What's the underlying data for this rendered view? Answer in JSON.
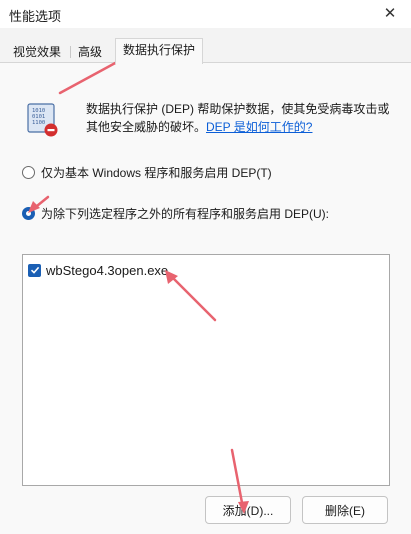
{
  "window": {
    "title": "性能选项",
    "close_icon": "close-icon"
  },
  "tabs": [
    {
      "label": "视觉效果"
    },
    {
      "label": "高级"
    },
    {
      "label": "数据执行保护"
    }
  ],
  "dep": {
    "icon": "dep-shield-icon",
    "description": "数据执行保护 (DEP) 帮助保护数据，使其免受病毒攻击或其他安全威胁的破坏。",
    "link": "DEP 是如何工作的?"
  },
  "options": {
    "essential_only": "仅为基本 Windows 程序和服务启用 DEP(T)",
    "all_except": "为除下列选定程序之外的所有程序和服务启用 DEP(U):",
    "selected": "all_except"
  },
  "program_list": [
    {
      "name": "wbStego4.3open.exe",
      "checked": true
    }
  ],
  "buttons": {
    "add": "添加(D)...",
    "remove": "删除(E)"
  },
  "colors": {
    "accent": "#1a5fb4",
    "annotation": "#e8636f",
    "link": "#0b5ed7"
  }
}
